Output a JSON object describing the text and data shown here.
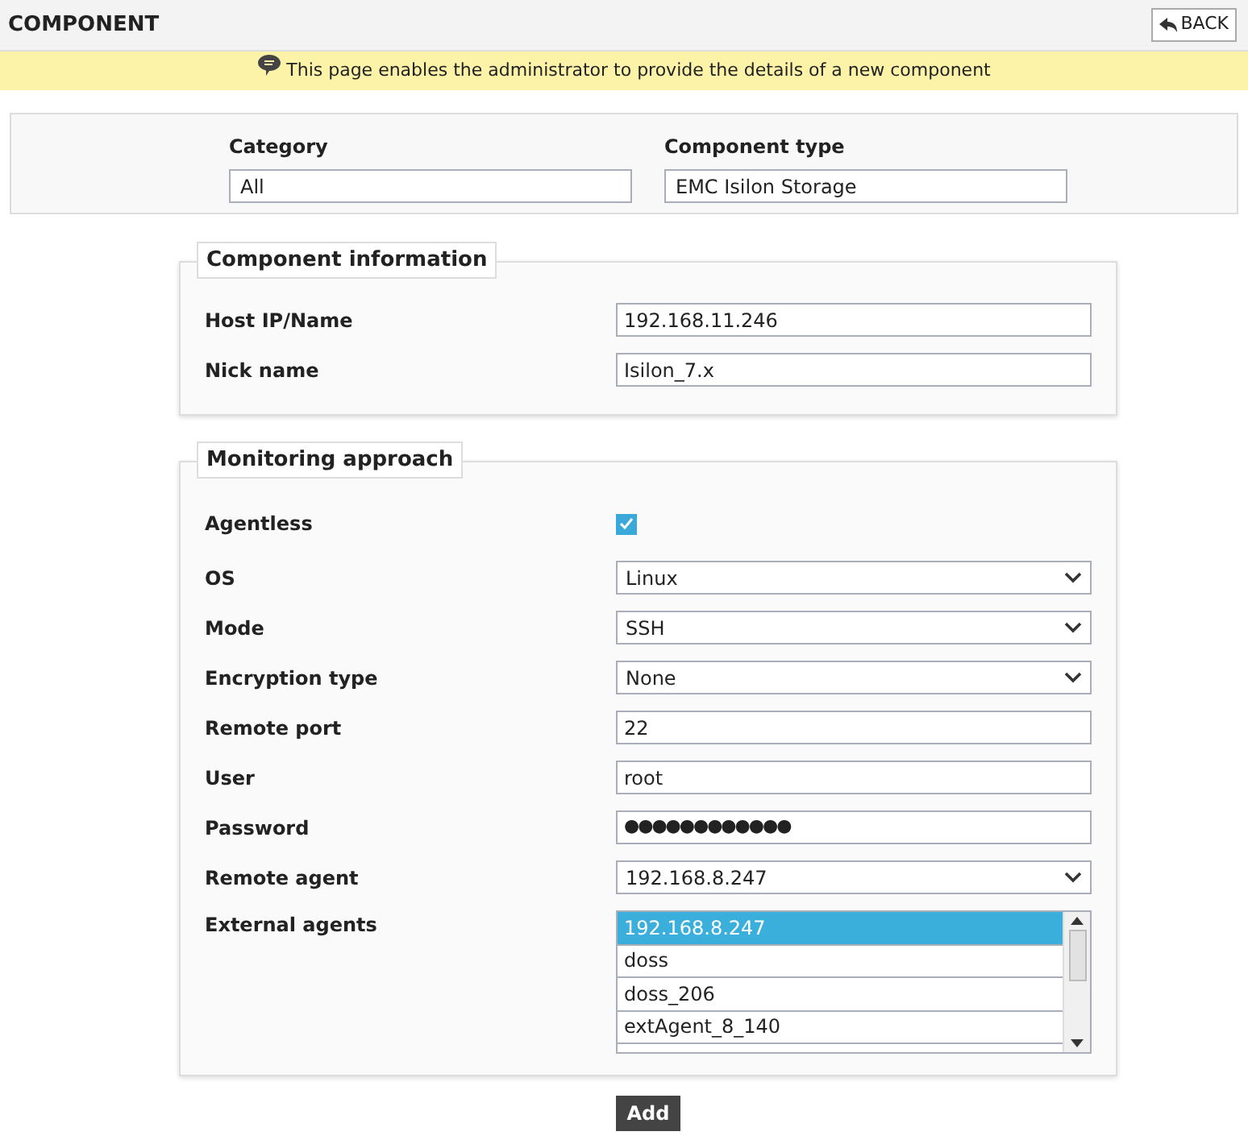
{
  "header": {
    "title": "COMPONENT",
    "back_button": "BACK"
  },
  "banner": {
    "text": "This page enables the administrator to provide the details of a new component"
  },
  "selection": [
    {
      "label": "Category",
      "value": "All"
    },
    {
      "label": "Component type",
      "value": "EMC Isilon Storage"
    }
  ],
  "sections": [
    {
      "legend": "Component information",
      "fields": [
        {
          "kind": "text",
          "label": "Host IP/Name",
          "value": "192.168.11.246"
        },
        {
          "kind": "text",
          "label": "Nick name",
          "value": "Isilon_7.x"
        }
      ]
    },
    {
      "legend": "Monitoring approach",
      "fields": [
        {
          "kind": "checkbox",
          "label": "Agentless",
          "checked": true
        },
        {
          "kind": "select",
          "label": "OS",
          "value": "Linux"
        },
        {
          "kind": "select",
          "label": "Mode",
          "value": "SSH"
        },
        {
          "kind": "select",
          "label": "Encryption type",
          "value": "None"
        },
        {
          "kind": "text",
          "label": "Remote port",
          "value": "22"
        },
        {
          "kind": "text",
          "label": "User",
          "value": "root"
        },
        {
          "kind": "password",
          "label": "Password",
          "value": "●●●●●●●●●●●●"
        },
        {
          "kind": "select",
          "label": "Remote agent",
          "value": "192.168.8.247"
        },
        {
          "kind": "listbox",
          "label": "External agents",
          "options": [
            {
              "label": "192.168.8.247",
              "selected": true
            },
            {
              "label": "doss",
              "selected": false
            },
            {
              "label": "doss_206",
              "selected": false
            },
            {
              "label": "extAgent_8_140",
              "selected": false
            }
          ]
        }
      ]
    }
  ],
  "add_button": "Add"
}
